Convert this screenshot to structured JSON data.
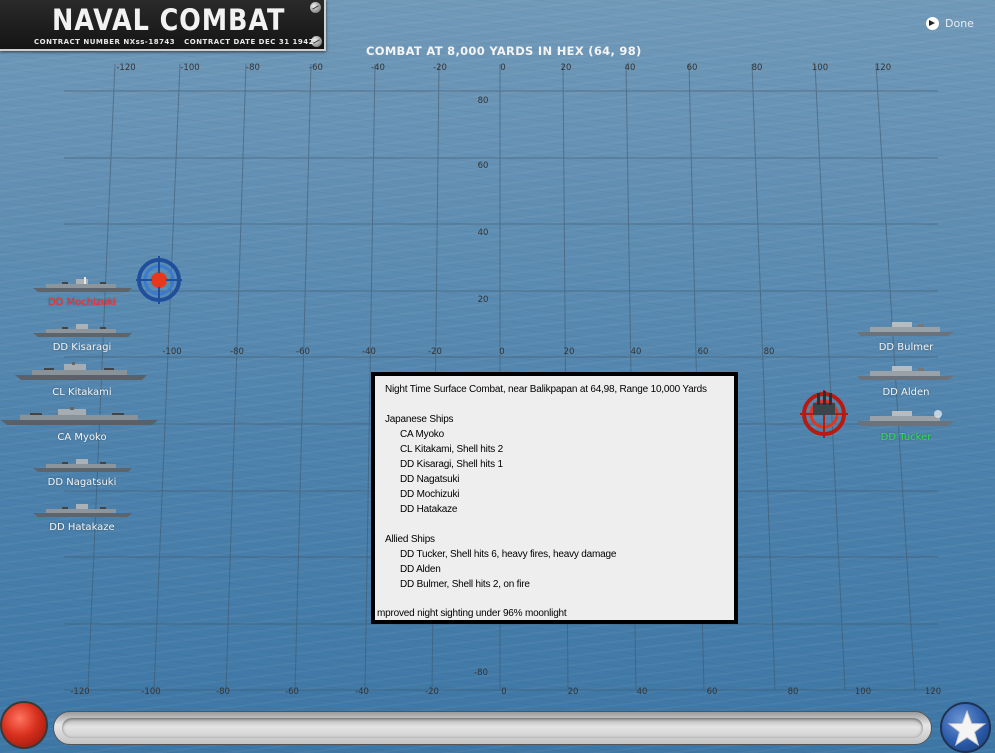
{
  "header": {
    "title": "NAVAL COMBAT",
    "contract_number": "CONTRACT NUMBER  NXss-18743",
    "contract_date": "CONTRACT DATE  DEC 31  1942"
  },
  "combat_title": "COMBAT AT 8,000 YARDS IN HEX (64, 98)",
  "done_label": "Done",
  "grid": {
    "top_labels": [
      "-120",
      "-100",
      "-80",
      "-60",
      "-40",
      "-20",
      "0",
      "20",
      "40",
      "60",
      "80",
      "100",
      "120"
    ],
    "mid_labels": [
      "-100",
      "-80",
      "-60",
      "-40",
      "-20",
      "0",
      "20",
      "40",
      "60",
      "80"
    ],
    "bottom_labels": [
      "-120",
      "-100",
      "-80",
      "-60",
      "-40",
      "-20",
      "0",
      "20",
      "40",
      "60",
      "80",
      "100",
      "120"
    ],
    "y_labels": [
      "80",
      "60",
      "40",
      "20",
      "-80"
    ]
  },
  "japanese_ships": [
    {
      "label": "DD Mochizuki",
      "status": "targeted"
    },
    {
      "label": "DD Kisaragi",
      "status": ""
    },
    {
      "label": "CL Kitakami",
      "status": ""
    },
    {
      "label": "CA Myoko",
      "status": ""
    },
    {
      "label": "DD Nagatsuki",
      "status": ""
    },
    {
      "label": "DD Hatakaze",
      "status": ""
    }
  ],
  "allied_ships": [
    {
      "label": "DD Bulmer",
      "status": ""
    },
    {
      "label": "DD Alden",
      "status": ""
    },
    {
      "label": "DD Tucker",
      "status": "active"
    }
  ],
  "report": {
    "heading": "Night Time Surface Combat, near Balikpapan at 64,98, Range 10,000 Yards",
    "japanese_header": "Japanese Ships",
    "japanese_lines": [
      "CA Myoko",
      "CL Kitakami, Shell hits 2",
      "DD Kisaragi, Shell hits 1",
      "DD Nagatsuki",
      "DD Mochizuki",
      "DD Hatakaze"
    ],
    "allied_header": "Allied Ships",
    "allied_lines": [
      "DD Tucker, Shell hits 6,  heavy fires,  heavy damage",
      "DD Alden",
      "DD Bulmer, Shell hits 2,  on fire"
    ],
    "footer": "mproved night sighting under 96% moonlight"
  },
  "colors": {
    "ocean": "#5083ad",
    "grid_line": "#3f5568",
    "targeted_label": "#ff2a2a",
    "active_label": "#30e04a",
    "report_bg": "#eeeeee"
  },
  "icons": {
    "done": "play-circle-icon",
    "japanese_target": "blue-crosshair-icon",
    "allied_target": "red-crosshair-icon",
    "left_button": "red-button-icon",
    "right_button": "star-icon"
  }
}
